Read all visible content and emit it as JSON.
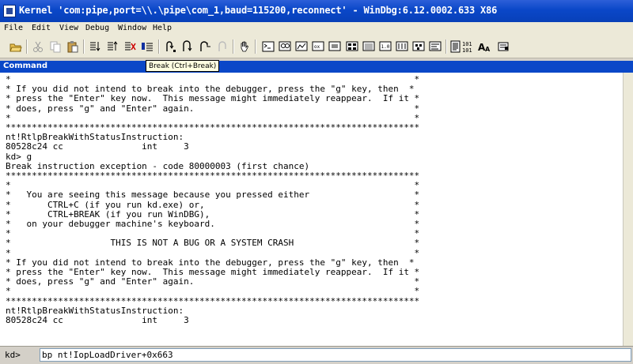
{
  "window": {
    "title": "Kernel 'com:pipe,port=\\\\.\\pipe\\com_1,baud=115200,reconnect' - WinDbg:6.12.0002.633 X86"
  },
  "menu": [
    "File",
    "Edit",
    "View",
    "Debug",
    "Window",
    "Help"
  ],
  "toolbar": {
    "buttons": [
      "open-icon",
      "cut-icon",
      "copy-icon",
      "paste-icon",
      "go-icon",
      "restart-icon",
      "stop-debugging-icon",
      "break-icon",
      "step-into-icon",
      "step-over-icon",
      "step-out-icon",
      "run-to-cursor-icon",
      "hand-icon",
      "command-window-icon",
      "watch-window-icon",
      "locals-window-icon",
      "registers-window-icon",
      "memory-window-icon",
      "call-stack-icon",
      "disassembly-window-icon",
      "scratch-pad-icon",
      "source-mode-icon",
      "hex-mode-icon",
      "font-icon",
      "options-icon"
    ],
    "tooltip": "Break (Ctrl+Break)"
  },
  "command_window": {
    "title": "Command",
    "lines": [
      "*                                                                             *",
      "* If you did not intend to break into the debugger, press the \"g\" key, then  *",
      "* press the \"Enter\" key now.  This message might immediately reappear.  If it *",
      "* does, press \"g\" and \"Enter\" again.                                          *",
      "*                                                                             *",
      "*******************************************************************************",
      "nt!RtlpBreakWithStatusInstruction:",
      "80528c24 cc               int     3",
      "kd> g",
      "Break instruction exception - code 80000003 (first chance)",
      "*******************************************************************************",
      "*                                                                             *",
      "*   You are seeing this message because you pressed either                    *",
      "*       CTRL+C (if you run kd.exe) or,                                        *",
      "*       CTRL+BREAK (if you run WinDBG),                                       *",
      "*   on your debugger machine's keyboard.                                      *",
      "*                                                                             *",
      "*                   THIS IS NOT A BUG OR A SYSTEM CRASH                       *",
      "*                                                                             *",
      "* If you did not intend to break into the debugger, press the \"g\" key, then  *",
      "* press the \"Enter\" key now.  This message might immediately reappear.  If it *",
      "* does, press \"g\" and \"Enter\" again.                                          *",
      "*                                                                             *",
      "*******************************************************************************",
      "nt!RtlpBreakWithStatusInstruction:",
      "80528c24 cc               int     3"
    ],
    "prompt": "kd>",
    "input_value": "bp nt!IopLoadDriver+0x663"
  }
}
